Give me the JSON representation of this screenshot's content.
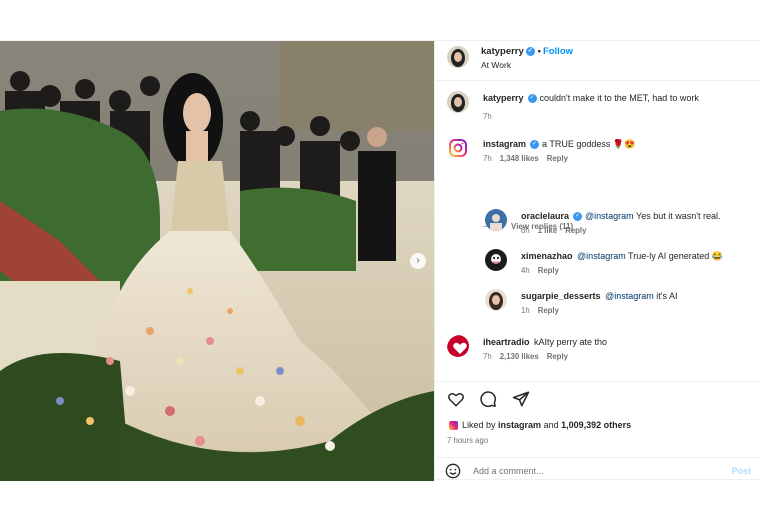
{
  "header": {
    "username": "katyperry",
    "follow_label": "Follow",
    "location": "At Work"
  },
  "caption": {
    "username": "katyperry",
    "text": "couldn't make it to the MET, had to work",
    "time": "7h"
  },
  "comments": [
    {
      "username": "instagram",
      "verified": true,
      "text": "a TRUE goddess 🌹😍",
      "time": "7h",
      "likes": "1,348 likes",
      "reply": "Reply"
    },
    {
      "username": "iheartradio",
      "verified": false,
      "text": "kAIty perry ate tho",
      "time": "7h",
      "likes": "2,130 likes",
      "reply": "Reply"
    }
  ],
  "view_replies": "View replies (11)",
  "replies": [
    {
      "username": "oraclelaura",
      "verified": true,
      "mention": "@instagram",
      "text": "Yes but it wasn't real.",
      "time": "6h",
      "likes": "1 like",
      "reply": "Reply"
    },
    {
      "username": "ximenazhao",
      "verified": false,
      "mention": "@instagram",
      "text": "True-ly AI generated 😂",
      "time": "4h",
      "reply": "Reply"
    },
    {
      "username": "sugarpie_desserts",
      "verified": false,
      "mention": "@instagram",
      "text": "it's AI",
      "time": "1h",
      "reply": "Reply"
    }
  ],
  "likes_line": {
    "prefix": "Liked by",
    "user": "instagram",
    "middle": "and",
    "count": "1,009,392 others"
  },
  "post_age": "7 hours ago",
  "add_comment": {
    "placeholder": "Add a comment...",
    "post_label": "Post"
  },
  "icons": [
    "heart-icon",
    "comment-icon",
    "share-icon",
    "smile-icon",
    "chevron-right-icon"
  ],
  "colors": {
    "follow_blue": "#0095f6",
    "verified_blue": "#3897f0",
    "instagram_gradient": [
      "#f9ce34",
      "#ee2a7b",
      "#6228d7"
    ],
    "iheart_red": "#c6002b"
  }
}
